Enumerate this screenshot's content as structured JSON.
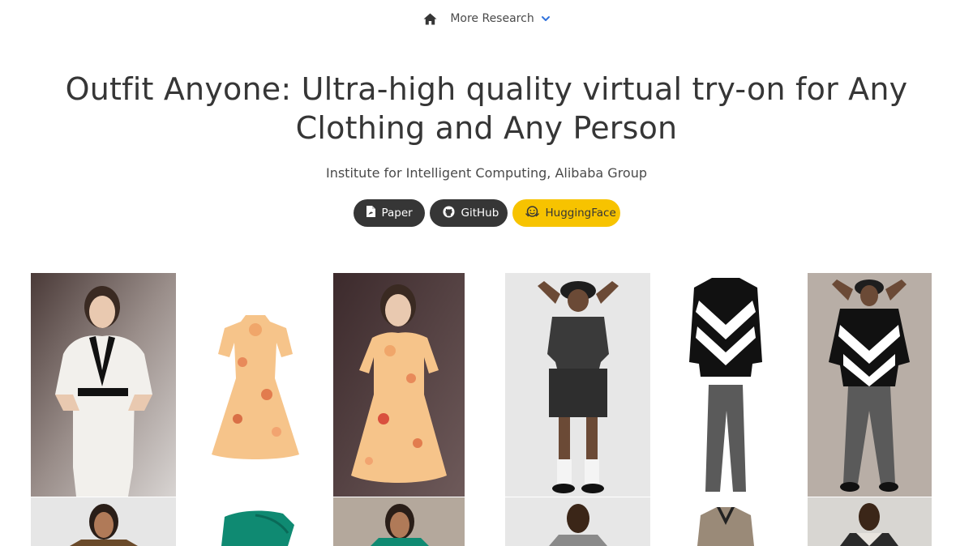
{
  "nav": {
    "home_icon": "home-icon",
    "more_research_label": "More Research",
    "chevron_icon": "chevron-down-icon"
  },
  "header": {
    "title": "Outfit Anyone: Ultra-high quality virtual try-on for Any Clothing and Any Person",
    "affiliation": "Institute for Intelligent Computing, Alibaba Group"
  },
  "links": [
    {
      "label": "Paper",
      "icon": "pdf-file-icon"
    },
    {
      "label": "GitHub",
      "icon": "github-icon"
    },
    {
      "label": "HuggingFace",
      "icon": "huggingface-icon"
    }
  ],
  "colors": {
    "text": "#363636",
    "dark_button": "#363636",
    "huggingface_button": "#f7c300",
    "chevron": "#3273dc"
  }
}
